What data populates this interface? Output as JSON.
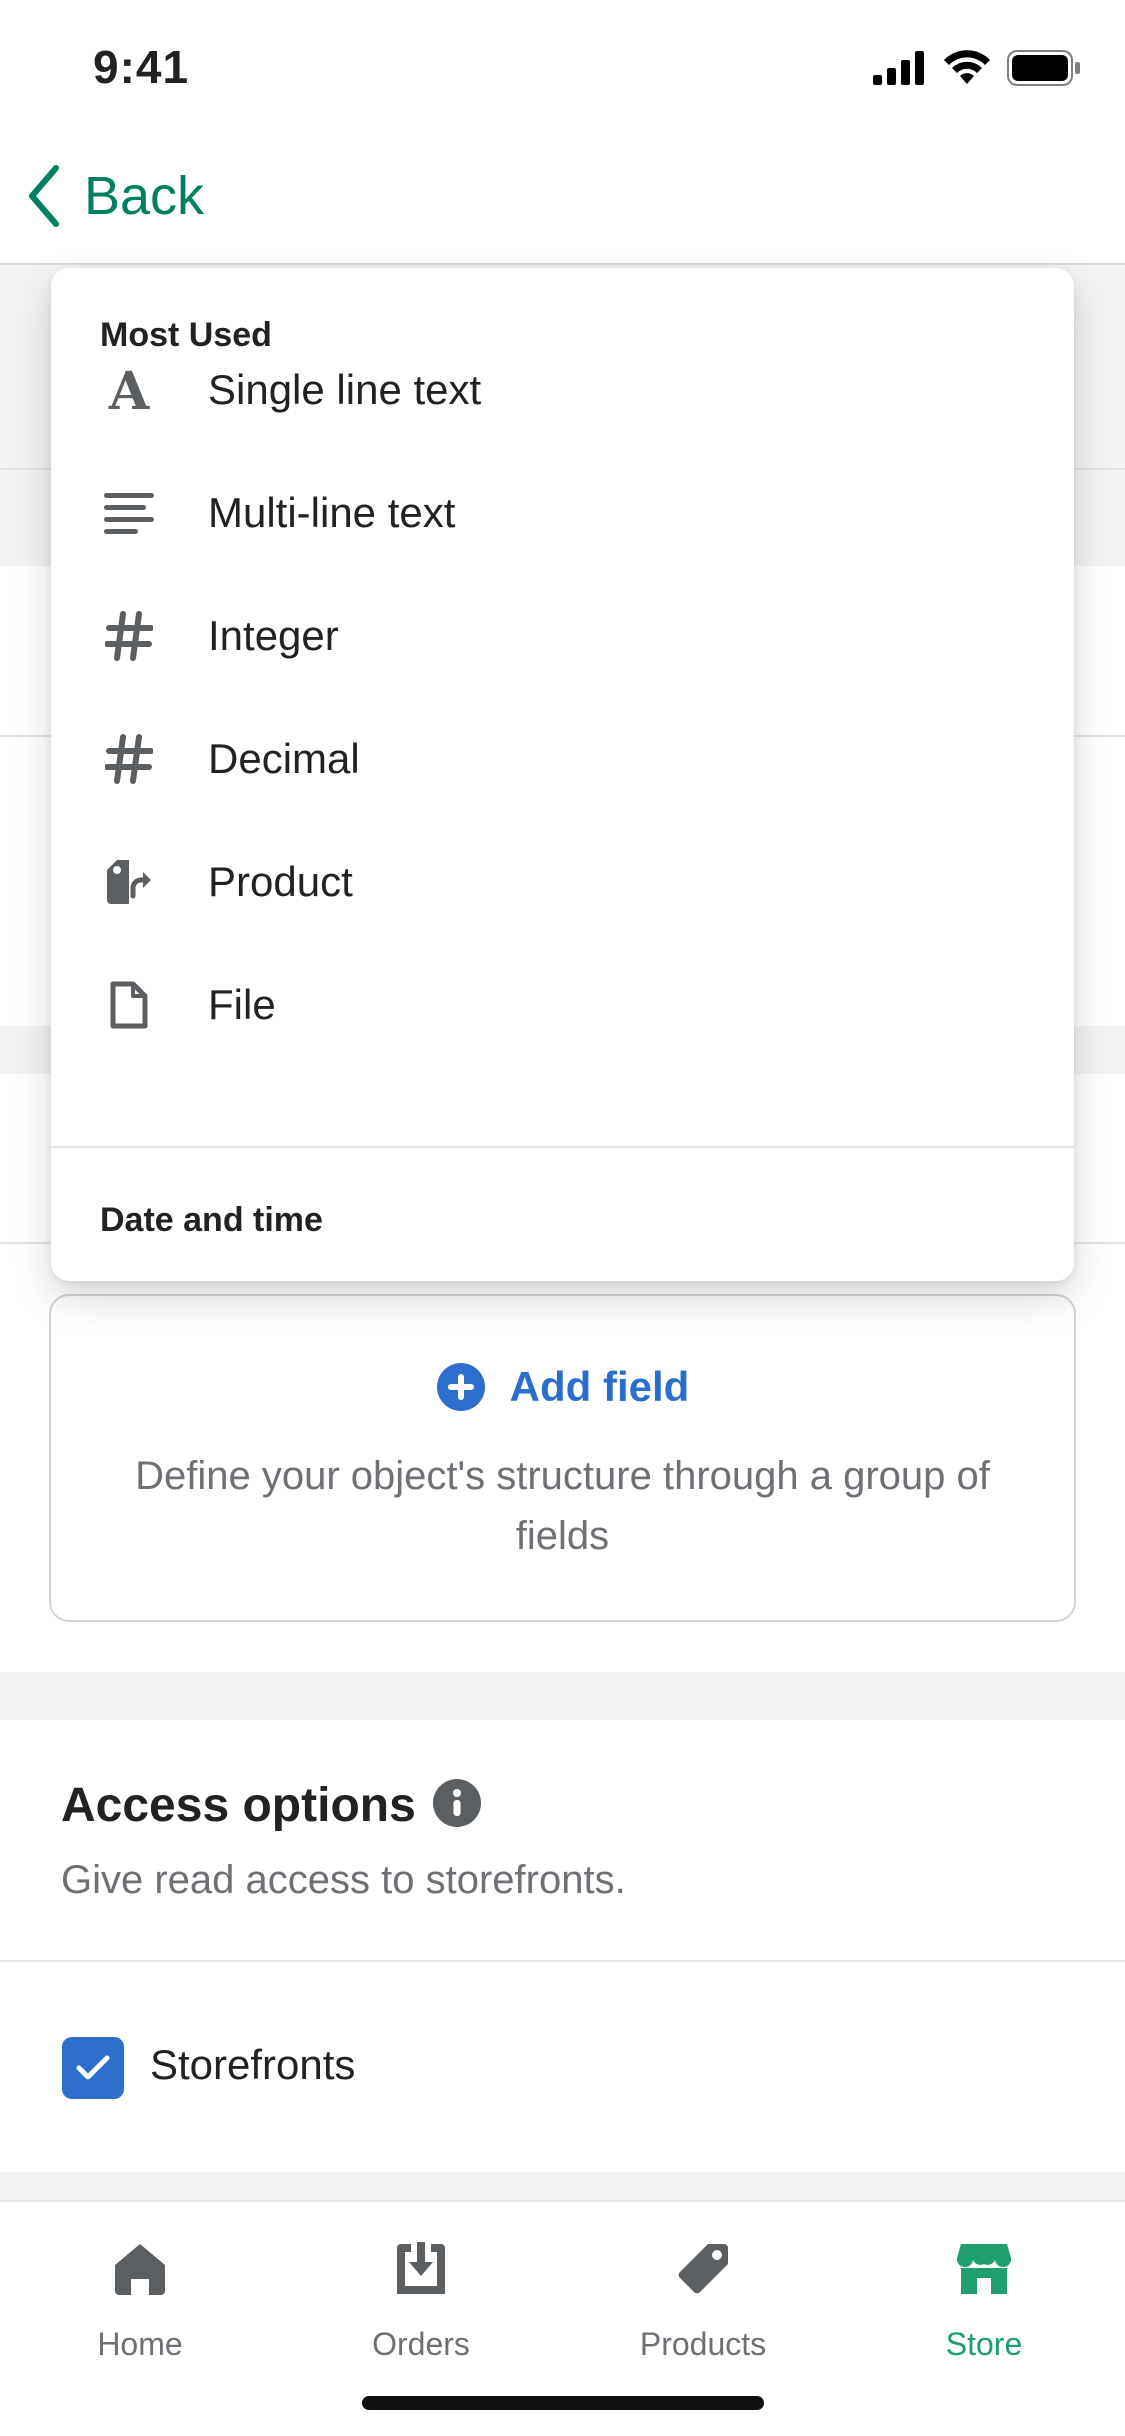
{
  "status_bar": {
    "time": "9:41",
    "icons": [
      "cellular-signal-icon",
      "wifi-icon",
      "battery-icon"
    ]
  },
  "nav": {
    "back_label": "Back",
    "back_icon": "chevron-left-icon"
  },
  "dropdown": {
    "sections": [
      {
        "title": "Most Used",
        "items": [
          {
            "label": "Single line text",
            "icon": "letter-a-icon"
          },
          {
            "label": "Multi-line text",
            "icon": "text-lines-icon"
          },
          {
            "label": "Integer",
            "icon": "hash-icon"
          },
          {
            "label": "Decimal",
            "icon": "hash-icon"
          },
          {
            "label": "Product",
            "icon": "product-tag-icon"
          },
          {
            "label": "File",
            "icon": "file-icon"
          }
        ]
      },
      {
        "title": "Date and time",
        "items": []
      }
    ]
  },
  "add_field": {
    "label": "Add field",
    "icon": "plus-circle-icon",
    "description": "Define your object's structure through a group of fields"
  },
  "access_options": {
    "title": "Access options",
    "info_icon": "info-icon",
    "description": "Give read access to storefronts.",
    "checkbox": {
      "label": "Storefronts",
      "checked": true
    }
  },
  "tab_bar": {
    "tabs": [
      {
        "label": "Home",
        "icon": "home-icon",
        "active": false
      },
      {
        "label": "Orders",
        "icon": "orders-icon",
        "active": false
      },
      {
        "label": "Products",
        "icon": "tag-icon",
        "active": false
      },
      {
        "label": "Store",
        "icon": "store-icon",
        "active": true
      }
    ]
  },
  "colors": {
    "accent_green": "#008060",
    "active_tab_green": "#1f9e6e",
    "link_blue": "#2c6ecb",
    "icon_gray": "#5c5f62"
  }
}
